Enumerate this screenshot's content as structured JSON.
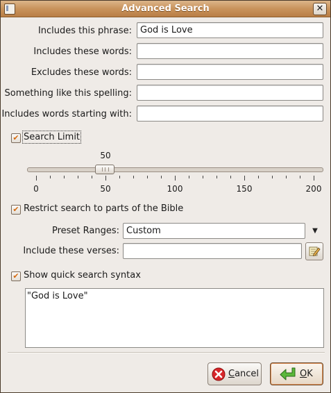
{
  "window": {
    "title": "Advanced Search"
  },
  "fields": [
    {
      "label": "Includes this phrase:",
      "value": "God is Love"
    },
    {
      "label": "Includes these words:",
      "value": ""
    },
    {
      "label": "Excludes these words:",
      "value": ""
    },
    {
      "label": "Something like this spelling:",
      "value": ""
    },
    {
      "label": "Includes words starting with:",
      "value": ""
    }
  ],
  "search_limit": {
    "label": "Search Limit",
    "checked": true,
    "value": "50",
    "min": 0,
    "max": 200,
    "tick_labels": [
      "0",
      "50",
      "100",
      "150",
      "200"
    ]
  },
  "restrict": {
    "label": "Restrict search to parts of the Bible",
    "checked": true,
    "preset_label": "Preset Ranges:",
    "preset_value": "Custom",
    "verses_label": "Include these verses:",
    "verses_value": ""
  },
  "quick_syntax": {
    "label": "Show quick search syntax",
    "checked": true,
    "text": "\"God is Love\""
  },
  "buttons": {
    "cancel_prefix": "",
    "cancel_mnemonic": "C",
    "cancel_rest": "ancel",
    "ok_mnemonic": "O",
    "ok_rest": "K"
  },
  "colors": {
    "titlebar": "#c9935c",
    "check_mark": "#d46a10",
    "cancel_icon": "#d8262a",
    "ok_icon": "#4aa02a"
  },
  "icons": {
    "window": "window-menu-icon",
    "close": "close-icon",
    "cancel": "cancel-icon",
    "ok": "ok-arrow-icon",
    "edit": "edit-pencil-icon"
  }
}
